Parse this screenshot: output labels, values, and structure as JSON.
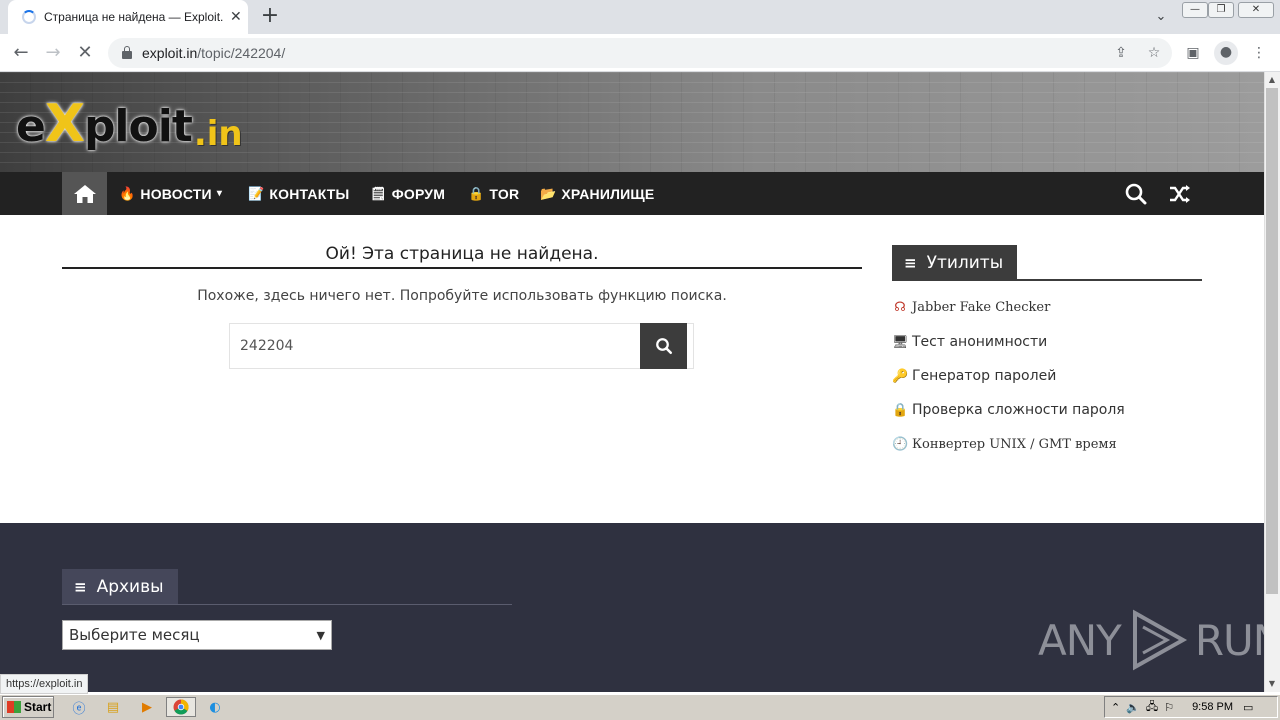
{
  "browser": {
    "tab_title": "Страница не найдена — Exploit.IN",
    "tab_close": "✕",
    "new_tab": "+",
    "url_host": "exploit.in",
    "url_path": "/topic/242204/",
    "status_url": "https://exploit.in"
  },
  "site": {
    "logo_prefix": "e",
    "logo_x": "X",
    "logo_mid": "ploit",
    "logo_suffix": ".in",
    "nav": [
      {
        "label": "НОВОСТИ",
        "emoji": "🔥",
        "caret": "▾"
      },
      {
        "label": "КОНТАКТЫ",
        "emoji": "📝"
      },
      {
        "label": "ФОРУМ",
        "emoji": "🗒"
      },
      {
        "label": "TOR",
        "emoji": "🔒"
      },
      {
        "label": "ХРАНИЛИЩЕ",
        "emoji": "📂"
      }
    ]
  },
  "main": {
    "title": "Ой! Эта страница не найдена.",
    "text": "Похоже, здесь ничего нет. Попробуйте использовать функцию поиска.",
    "search_value": "242204"
  },
  "sidebar": {
    "heading": "Утилиты",
    "items": [
      {
        "label": "Jabber Fake Checker",
        "icon": "☊"
      },
      {
        "label": "Тест анонимности",
        "icon": "🖥"
      },
      {
        "label": "Генератор паролей",
        "icon": "🔑"
      },
      {
        "label": "Проверка сложности пароля",
        "icon": "🔒"
      },
      {
        "label": "Конвертер UNIX / GMT время",
        "icon": "🕘"
      }
    ]
  },
  "footer": {
    "archive_heading": "Архивы",
    "archive_select": "Выберите месяц",
    "watermark_left": "ANY",
    "watermark_right": "RUN"
  },
  "taskbar": {
    "start_label": "Start",
    "clock": "9:58 PM"
  }
}
